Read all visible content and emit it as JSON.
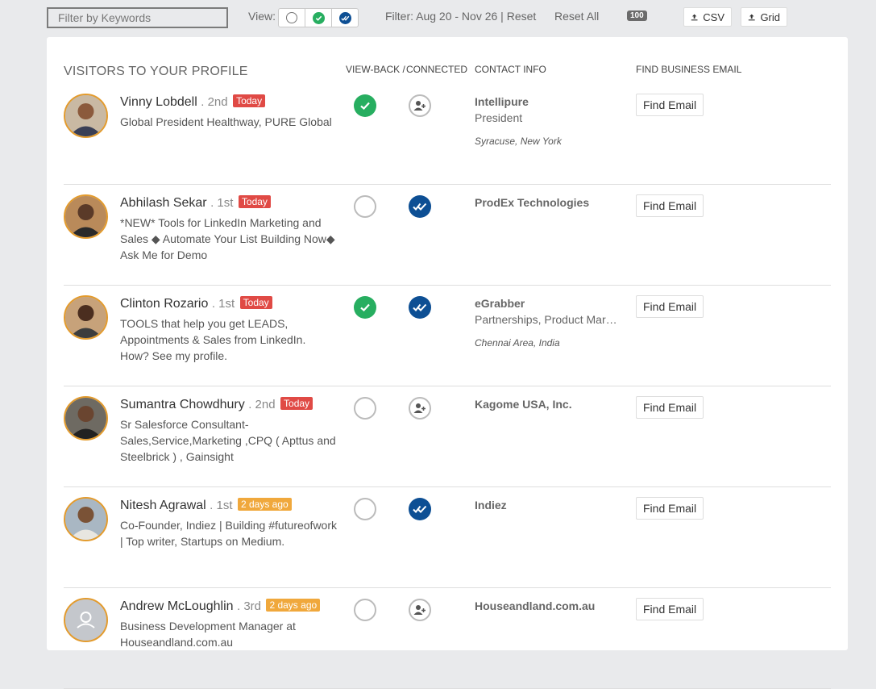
{
  "toolbar": {
    "filter_placeholder": "Filter by Keywords",
    "view_label": "View:",
    "filter_text": "Filter: Aug 20 - Nov 26 | ",
    "reset_label": "Reset",
    "reset_all_label": "Reset All",
    "count": "100",
    "csv_label": "CSV",
    "grid_label": "Grid"
  },
  "panel": {
    "title": "VISITORS TO YOUR PROFILE",
    "headers": {
      "viewback": "VIEW-BACK /",
      "connected": "CONNECTED",
      "contact": "CONTACT INFO",
      "find": "FIND BUSINESS EMAIL"
    }
  },
  "colors": {
    "accent_green": "#27ae60",
    "accent_blue": "#0d4f94",
    "today_badge": "#e04a45",
    "days_badge": "#f0a83c",
    "avatar_ring": "#e39b2d"
  },
  "visitors": [
    {
      "name": "Vinny Lobdell",
      "degree": ". 2nd",
      "badge": "Today",
      "badge_type": "today",
      "headline": "Global President Healthway, PURE Global",
      "viewback": true,
      "connected": false,
      "company": "Intellipure",
      "title": "President",
      "location": "Syracuse, New York",
      "find_label": "Find Email",
      "avatar_icon": "person-photo"
    },
    {
      "name": "Abhilash Sekar",
      "degree": ". 1st",
      "badge": "Today",
      "badge_type": "today",
      "headline": "*NEW* Tools for LinkedIn Marketing and Sales ◆ Automate Your List Building Now◆ Ask Me for Demo",
      "viewback": false,
      "connected": true,
      "company": "ProdEx Technologies",
      "title": "",
      "location": "",
      "find_label": "Find Email",
      "avatar_icon": "person-photo"
    },
    {
      "name": "Clinton Rozario",
      "degree": ". 1st",
      "badge": "Today",
      "badge_type": "today",
      "headline": "TOOLS that help you get LEADS, Appointments & Sales from LinkedIn. How? See my profile.",
      "viewback": true,
      "connected": true,
      "company": "eGrabber",
      "title": "Partnerships, Product Marketing",
      "location": "Chennai Area, India",
      "find_label": "Find Email",
      "avatar_icon": "person-photo"
    },
    {
      "name": "Sumantra Chowdhury",
      "degree": ". 2nd",
      "badge": "Today",
      "badge_type": "today",
      "headline": "Sr Salesforce Consultant- Sales,Service,Marketing ,CPQ ( Apttus and Steelbrick ) , Gainsight",
      "viewback": false,
      "connected": false,
      "company": "Kagome USA, Inc.",
      "title": "",
      "location": "",
      "find_label": "Find Email",
      "avatar_icon": "person-photo"
    },
    {
      "name": "Nitesh Agrawal",
      "degree": ". 1st",
      "badge": "2 days ago",
      "badge_type": "days",
      "headline": "Co-Founder, Indiez | Building #futureofwork | Top writer, Startups on Medium.",
      "viewback": false,
      "connected": true,
      "company": "Indiez",
      "title": "",
      "location": "",
      "find_label": "Find Email",
      "avatar_icon": "person-photo"
    },
    {
      "name": "Andrew McLoughlin",
      "degree": ". 3rd",
      "badge": "2 days ago",
      "badge_type": "days",
      "headline": "Business Development Manager at Houseandland.com.au",
      "viewback": false,
      "connected": false,
      "company": "Houseandland.com.au",
      "title": "",
      "location": "",
      "find_label": "Find Email",
      "avatar_icon": "default-avatar"
    }
  ]
}
